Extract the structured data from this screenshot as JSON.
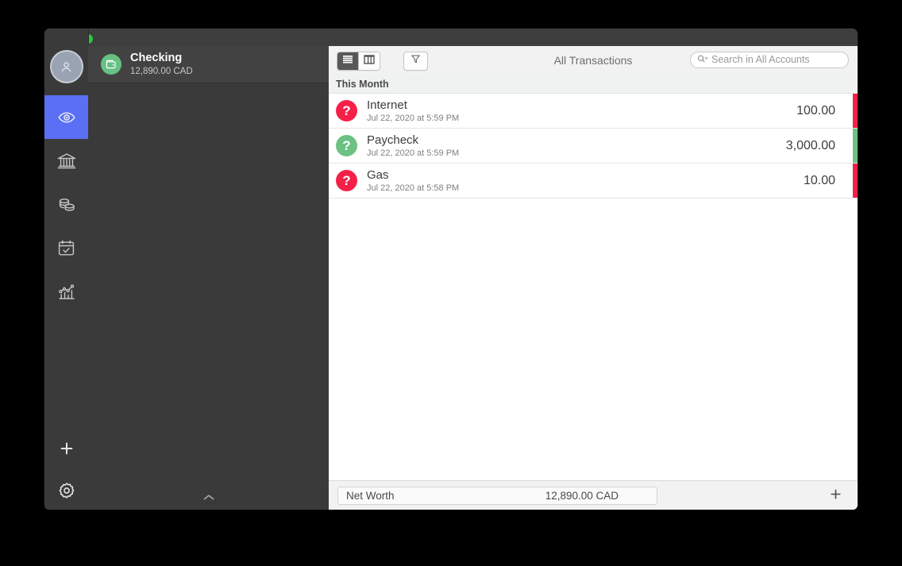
{
  "window": {
    "traffic_lights": [
      {
        "name": "close",
        "color": "#FE5F57"
      },
      {
        "name": "minimize",
        "color": "#FEBC2E"
      },
      {
        "name": "zoom",
        "color": "#28C840"
      }
    ]
  },
  "rail": {
    "avatar_icon": "person-avatar-icon",
    "items": [
      {
        "icon": "eye-icon",
        "name": "overview",
        "selected": true
      },
      {
        "icon": "bank-icon",
        "name": "accounts",
        "selected": false
      },
      {
        "icon": "coins-icon",
        "name": "budgets",
        "selected": false
      },
      {
        "icon": "calendar-check-icon",
        "name": "scheduled",
        "selected": false
      },
      {
        "icon": "chart-icon",
        "name": "reports",
        "selected": false
      }
    ],
    "bottom_items": [
      {
        "icon": "plus-icon",
        "name": "add",
        "label": "+"
      },
      {
        "icon": "gear-icon",
        "name": "settings"
      }
    ]
  },
  "account_panel": {
    "account_icon": "wallet-icon",
    "account_icon_color": "#66C183",
    "name": "Checking",
    "balance": "12,890.00 CAD",
    "collapse_icon": "chevron-up-icon",
    "collapse_glyph": "⌃"
  },
  "toolbar": {
    "view_modes": [
      {
        "name": "list-view",
        "icon": "list-view-icon",
        "selected": true
      },
      {
        "name": "column-view",
        "icon": "column-view-icon",
        "selected": false
      }
    ],
    "filter": {
      "name": "filter-button",
      "icon": "funnel-icon"
    },
    "title": "All Transactions",
    "search": {
      "icon": "search-icon",
      "placeholder": "Search in All Accounts",
      "value": ""
    }
  },
  "transactions": {
    "section_label": "This Month",
    "rows": [
      {
        "payee": "Internet",
        "date": "Jul 22, 2020 at 5:59 PM",
        "amount": "100.00",
        "icon": "question-mark-icon",
        "icon_glyph": "?",
        "icon_color": "#F52048",
        "bar_color": "#F52048"
      },
      {
        "payee": "Paycheck",
        "date": "Jul 22, 2020 at 5:59 PM",
        "amount": "3,000.00",
        "icon": "question-mark-icon",
        "icon_glyph": "?",
        "icon_color": "#6CC183",
        "bar_color": "#6CC183"
      },
      {
        "payee": "Gas",
        "date": "Jul 22, 2020 at 5:58 PM",
        "amount": "10.00",
        "icon": "question-mark-icon",
        "icon_glyph": "?",
        "icon_color": "#F52048",
        "bar_color": "#F52048"
      }
    ]
  },
  "footer": {
    "networth_label": "Net Worth",
    "networth_value": "12,890.00 CAD",
    "add_icon": "plus-icon",
    "add_glyph": "+"
  }
}
